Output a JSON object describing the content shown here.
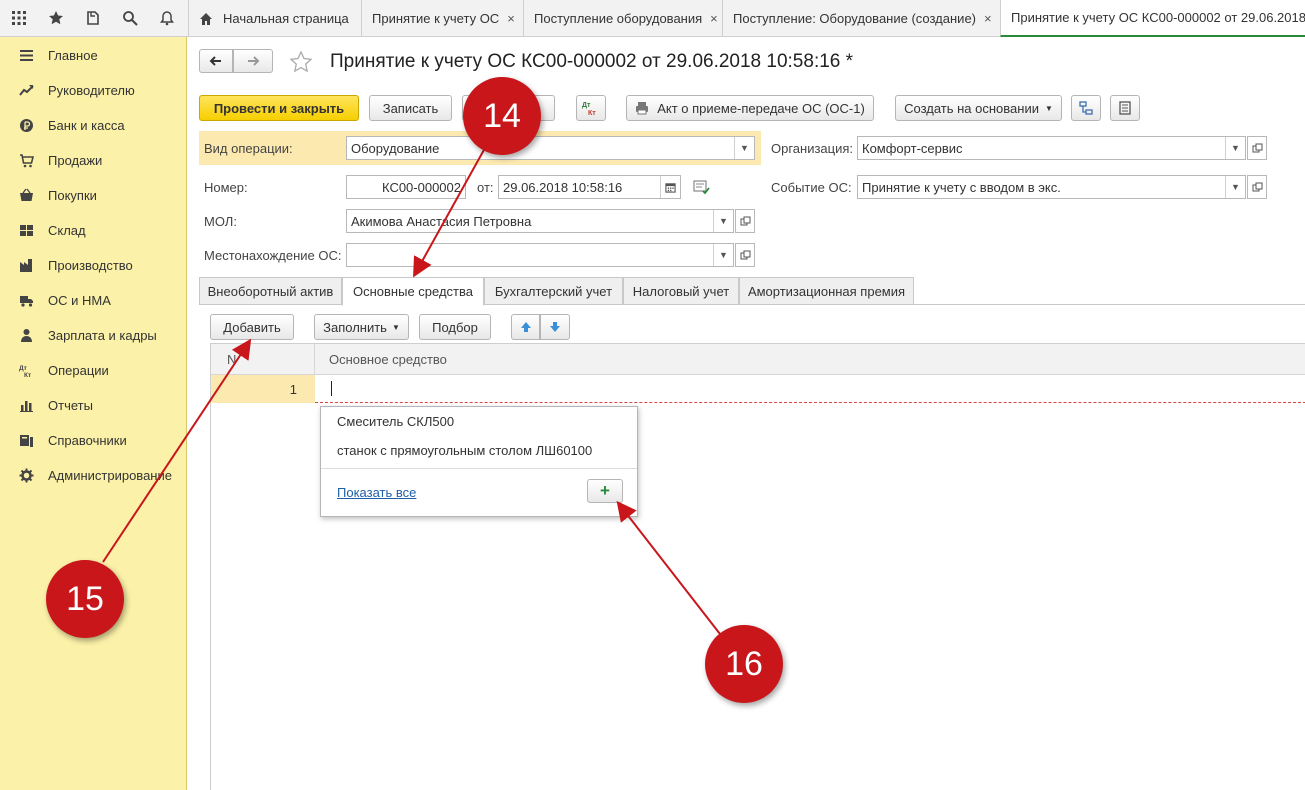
{
  "topbar": {
    "icons": [
      "apps-grid-icon",
      "star-icon",
      "history-icon",
      "search-icon",
      "bell-icon"
    ],
    "tabs": [
      {
        "label": "Начальная страница",
        "closable": false
      },
      {
        "label": "Принятие к учету ОС",
        "closable": true
      },
      {
        "label": "Поступление оборудования",
        "closable": true
      },
      {
        "label": "Поступление: Оборудование (создание)",
        "closable": true
      },
      {
        "label": "Принятие к учету ОС КС00-000002 от 29.06.2018",
        "closable": false,
        "active": true
      }
    ],
    "close_glyph": "×"
  },
  "sidebar": {
    "items": [
      {
        "label": "Главное",
        "icon": "menu-icon"
      },
      {
        "label": "Руководителю",
        "icon": "trend-icon"
      },
      {
        "label": "Банк и касса",
        "icon": "ruble-icon"
      },
      {
        "label": "Продажи",
        "icon": "cart-icon"
      },
      {
        "label": "Покупки",
        "icon": "basket-icon"
      },
      {
        "label": "Склад",
        "icon": "warehouse-icon"
      },
      {
        "label": "Производство",
        "icon": "factory-icon"
      },
      {
        "label": "ОС и НМА",
        "icon": "truck-icon"
      },
      {
        "label": "Зарплата и кадры",
        "icon": "person-icon"
      },
      {
        "label": "Операции",
        "icon": "debit-credit-icon"
      },
      {
        "label": "Отчеты",
        "icon": "chart-icon"
      },
      {
        "label": "Справочники",
        "icon": "books-icon"
      },
      {
        "label": "Администрирование",
        "icon": "gear-icon"
      }
    ]
  },
  "document": {
    "title": "Принятие к учету ОС КС00-000002 от 29.06.2018 10:58:16 *"
  },
  "toolbar": {
    "post_close": "Провести и закрыть",
    "save": "Записать",
    "dt_kt": "Дт Кт",
    "act": "Акт о приеме-передаче ОС (ОС-1)",
    "create_based": "Создать на основании"
  },
  "form": {
    "operation_label": "Вид операции:",
    "operation_value": "Оборудование",
    "number_label": "Номер:",
    "number_value": "КС00-000002",
    "date_label": "от:",
    "date_value": "29.06.2018 10:58:16",
    "mol_label": "МОЛ:",
    "mol_value": "Акимова Анастасия Петровна",
    "location_label": "Местонахождение ОС:",
    "location_value": "",
    "org_label": "Организация:",
    "org_value": "Комфорт-сервис",
    "event_label": "Событие ОС:",
    "event_value": "Принятие к учету с вводом в экс."
  },
  "tabs": [
    {
      "label": "Внеоборотный актив"
    },
    {
      "label": "Основные средства",
      "active": true
    },
    {
      "label": "Бухгалтерский учет"
    },
    {
      "label": "Налоговый учет"
    },
    {
      "label": "Амортизационная премия"
    }
  ],
  "table_toolbar": {
    "add": "Добавить",
    "fill": "Заполнить",
    "pick": "Подбор"
  },
  "table": {
    "columns": [
      "N",
      "Основное средство"
    ],
    "rows": [
      {
        "n": "1",
        "asset": ""
      }
    ]
  },
  "popup": {
    "items": [
      "Смеситель СКЛ500",
      "станок с прямоугольным столом ЛШ60100"
    ],
    "show_all": "Показать все",
    "add_glyph": "+"
  },
  "annotations": {
    "m14": "14",
    "m15": "15",
    "m16": "16",
    "color": "#c8161b"
  }
}
